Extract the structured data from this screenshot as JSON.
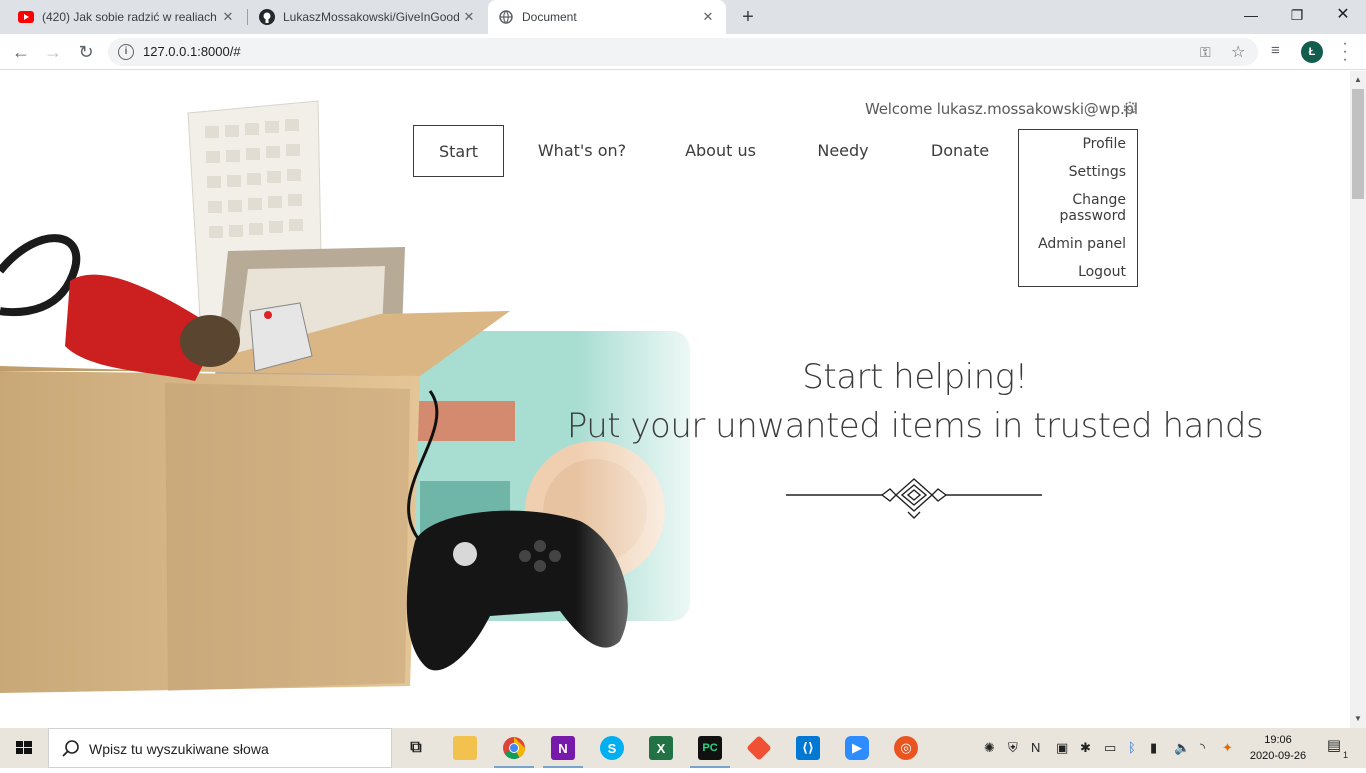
{
  "browser": {
    "tabs": [
      {
        "title": "(420) Jak sobie radzić w realiach (",
        "favicon": "youtube-icon"
      },
      {
        "title": "LukaszMossakowski/GiveInGood",
        "favicon": "github-icon"
      },
      {
        "title": "Document",
        "favicon": "globe-icon"
      }
    ],
    "url": "127.0.0.1:8000/#",
    "profile_initial": "Ł"
  },
  "page": {
    "welcome": "Welcome lukasz.mossakowski@wp.pl",
    "nav": [
      "Start",
      "What's on?",
      "About us",
      "Needy",
      "Donate"
    ],
    "active_nav": "Start",
    "user_menu": [
      "Profile",
      "Settings",
      "Change password",
      "Admin panel",
      "Logout"
    ],
    "headline_1": "Start helping!",
    "headline_2": "Put your unwanted items in trusted hands"
  },
  "taskbar": {
    "search_placeholder": "Wpisz tu wyszukiwane słowa",
    "time": "19:06",
    "date": "2020-09-26",
    "notification_count": "1",
    "apps": [
      "task-view-icon",
      "file-explorer-icon",
      "chrome-icon",
      "onenote-icon",
      "skype-icon",
      "excel-icon",
      "pycharm-icon",
      "git-icon",
      "vscode-icon",
      "zoom-icon",
      "ubuntu-icon"
    ]
  },
  "colors": {
    "text": "#3c3c3c",
    "tabbar": "#dee1e6",
    "taskbar": "#e9e5dc",
    "avatar": "#135d4e"
  }
}
